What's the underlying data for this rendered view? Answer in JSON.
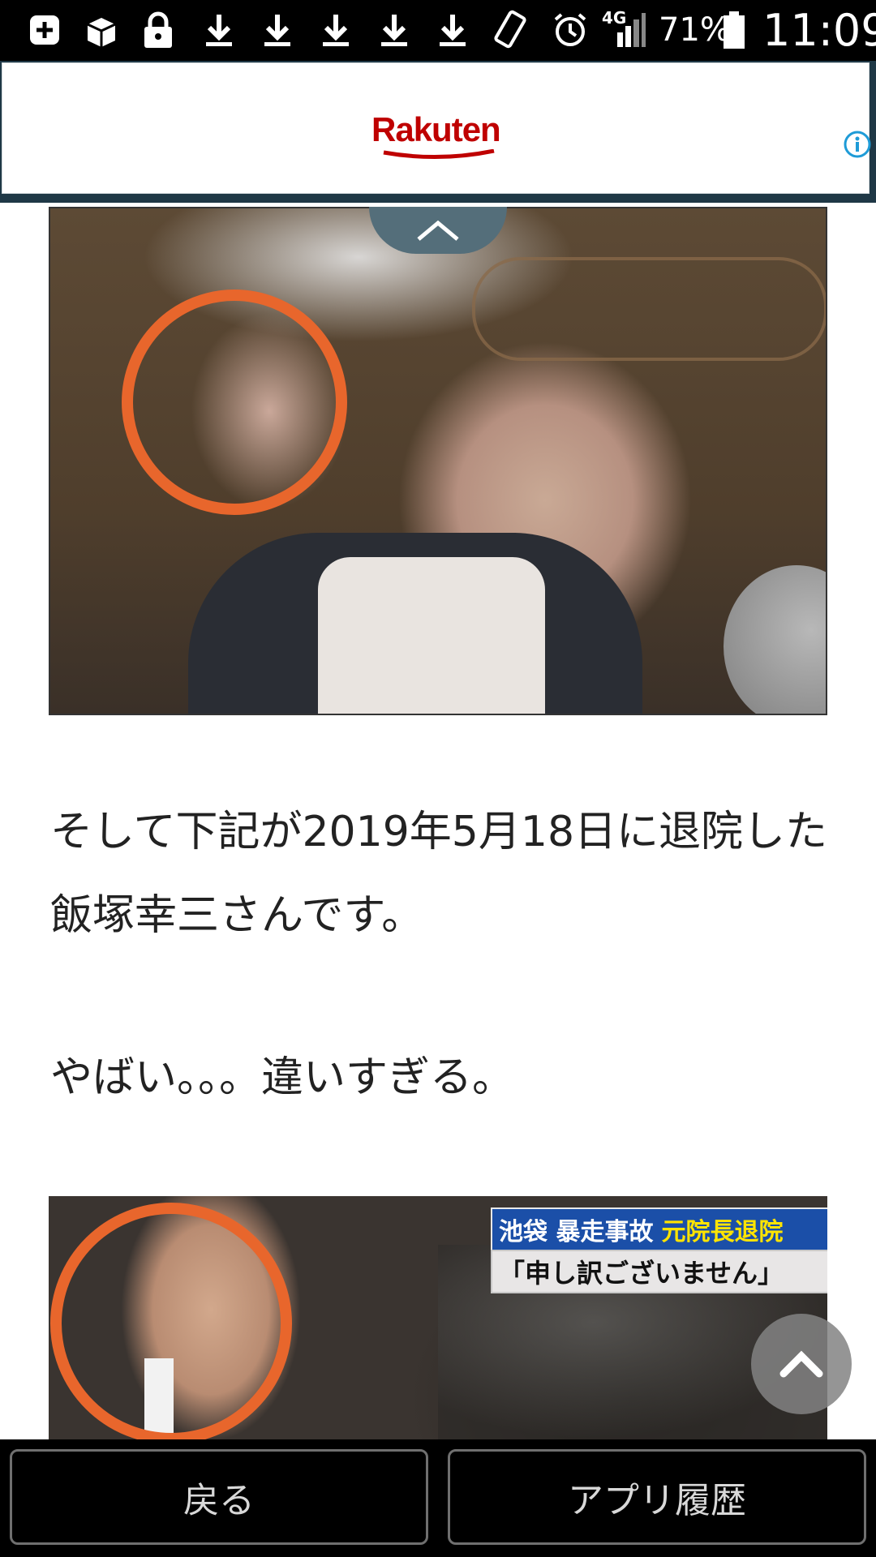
{
  "status_bar": {
    "network": "4G",
    "battery": "71%",
    "time": "11:09",
    "icons": [
      "add-box-icon",
      "package-icon",
      "lock-icon",
      "download-icon",
      "download-icon",
      "download-icon",
      "download-icon",
      "download-icon",
      "screen-rotate-icon",
      "alarm-icon",
      "signal-icon",
      "battery-icon"
    ]
  },
  "ad": {
    "brand": "Rakuten",
    "brand_color": "#bf0000",
    "info_icon": "info-icon"
  },
  "article": {
    "paragraph1": "そして下記が2019年5月18日に退院した飯塚幸三さんです。",
    "paragraph2": "やばい。。。違いすぎる。",
    "image2_caption": {
      "line1_part1": "池袋 暴走事故",
      "line1_part2": "元院長退院",
      "line2": "「申し訳ございません」"
    }
  },
  "bottom_nav": {
    "back_label": "戻る",
    "history_label": "アプリ履歴"
  },
  "colors": {
    "accent_circle": "#e8662c",
    "collapse_tab": "#546e7a"
  }
}
